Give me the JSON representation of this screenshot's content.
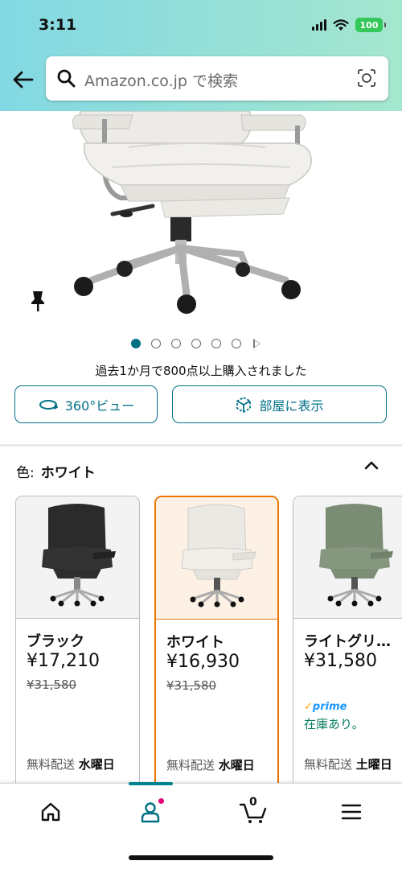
{
  "status": {
    "time": "3:11",
    "battery": "100"
  },
  "search": {
    "placeholder": "Amazon.co.jp で検索"
  },
  "gallery": {
    "image_count": 6,
    "active_index": 0
  },
  "purchase_note": "過去1か月で800点以上購入されました",
  "actions": {
    "view_360_label": "360°ビュー",
    "view_in_room_label": "部屋に表示"
  },
  "color_selector": {
    "label": "色:",
    "selected": "ホワイト"
  },
  "variants": [
    {
      "name": "ブラック",
      "price": "¥17,210",
      "list_price": "¥31,580",
      "prime": "",
      "stock": "",
      "delivery_prefix": "無料配送",
      "delivery_day": "水曜日",
      "color": "#2b2b2b"
    },
    {
      "name": "ホワイト",
      "price": "¥16,930",
      "list_price": "¥31,580",
      "prime": "",
      "stock": "",
      "delivery_prefix": "無料配送",
      "delivery_day": "水曜日",
      "color": "#e8e6e1"
    },
    {
      "name": "ライトグリ…",
      "price": "¥31,580",
      "list_price": "",
      "prime": "prime",
      "stock": "在庫あり。",
      "delivery_prefix": "無料配送",
      "delivery_day": "土曜日",
      "color": "#7b8c74"
    }
  ],
  "bottom_nav": {
    "cart_count": "0"
  },
  "colors": {
    "accent": "#007185",
    "selected_border": "#e77600",
    "badge": "#e4007c"
  }
}
